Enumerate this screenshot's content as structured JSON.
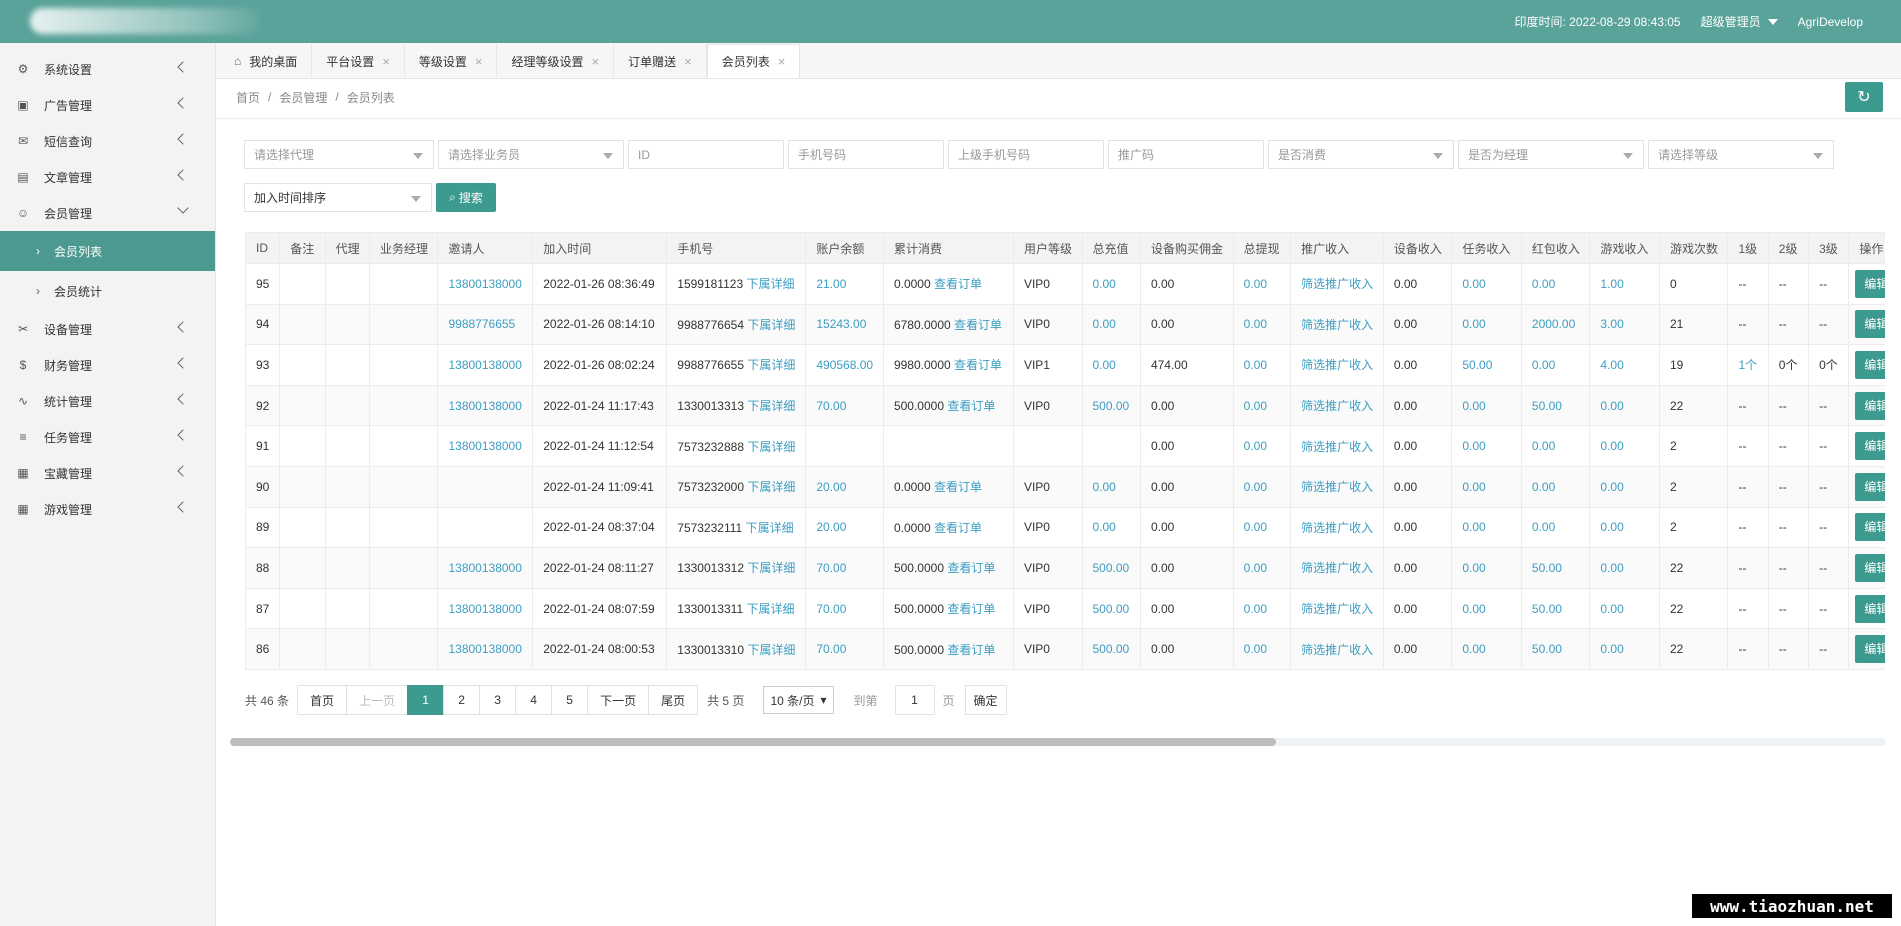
{
  "topbar": {
    "india_time": "印度时间: 2022-08-29 08:43:05",
    "admin_label": "超级管理员",
    "user": "AgriDevelop"
  },
  "sidebar": {
    "items": [
      {
        "label": "系统设置",
        "icon": "gear-icon",
        "glyph": "⚙"
      },
      {
        "label": "广告管理",
        "icon": "image-icon",
        "glyph": "▣"
      },
      {
        "label": "短信查询",
        "icon": "mail-icon",
        "glyph": "✉"
      },
      {
        "label": "文章管理",
        "icon": "book-icon",
        "glyph": "▤"
      },
      {
        "label": "会员管理",
        "icon": "user-icon",
        "glyph": "☺"
      }
    ],
    "sub_items": [
      {
        "label": "会员列表"
      },
      {
        "label": "会员统计"
      }
    ],
    "items2": [
      {
        "label": "设备管理",
        "icon": "wrench-icon",
        "glyph": "✂"
      },
      {
        "label": "财务管理",
        "icon": "dollar-icon",
        "glyph": "$"
      },
      {
        "label": "统计管理",
        "icon": "pulse-icon",
        "glyph": "∿"
      },
      {
        "label": "任务管理",
        "icon": "sliders-icon",
        "glyph": "≡"
      },
      {
        "label": "宝藏管理",
        "icon": "gift-icon",
        "glyph": "▦"
      },
      {
        "label": "游戏管理",
        "icon": "gift-icon",
        "glyph": "▦"
      }
    ]
  },
  "tabs": [
    {
      "label": "我的桌面"
    },
    {
      "label": "平台设置"
    },
    {
      "label": "等级设置"
    },
    {
      "label": "经理等级设置"
    },
    {
      "label": "订单赠送"
    },
    {
      "label": "会员列表"
    }
  ],
  "breadcrumb": [
    "首页",
    "会员管理",
    "会员列表"
  ],
  "filters": {
    "row1": [
      {
        "text": "请选择代理",
        "type": "select",
        "w": 190
      },
      {
        "text": "请选择业务员",
        "type": "select",
        "w": 186
      },
      {
        "text": "ID",
        "type": "input",
        "w": 156
      },
      {
        "text": "手机号码",
        "type": "input",
        "w": 156
      },
      {
        "text": "上级手机号码",
        "type": "input",
        "w": 156
      },
      {
        "text": "推广码",
        "type": "input",
        "w": 156
      },
      {
        "text": "是否消费",
        "type": "select",
        "w": 186
      },
      {
        "text": "是否为经理",
        "type": "select",
        "w": 186
      },
      {
        "text": "请选择等级",
        "type": "select",
        "w": 186
      }
    ],
    "sort": "加入时间排序",
    "search_label": "搜索"
  },
  "table": {
    "headers": [
      "ID",
      "备注",
      "代理",
      "业务经理",
      "邀请人",
      "加入时间",
      "手机号",
      "账户余额",
      "累计消费",
      "用户等级",
      "总充值",
      "设备购买佣金",
      "总提现",
      "推广收入",
      "设备收入",
      "任务收入",
      "红包收入",
      "游戏收入",
      "游戏次数",
      "1级",
      "2级",
      "3级",
      "操作"
    ],
    "detail_link": "下属详细",
    "order_link": "查看订单",
    "promo_link": "筛选推广收入",
    "edit_label": "编辑",
    "rows": [
      {
        "id": "95",
        "inviter": "13800138000",
        "time": "2022-01-26 08:36:49",
        "phone": "1599181123",
        "balance": "21.00",
        "consume": "0.0000",
        "level": "VIP0",
        "recharge": "0.00",
        "device_comm": "0.00",
        "withdraw": "0.00",
        "device_inc": "0.00",
        "task_inc": "0.00",
        "red_inc": "0.00",
        "game_inc": "1.00",
        "game_cnt": "0",
        "l1": "--",
        "l2": "--",
        "l3": "--"
      },
      {
        "id": "94",
        "inviter": "9988776655",
        "time": "2022-01-26 08:14:10",
        "phone": "9988776654",
        "balance": "15243.00",
        "consume": "6780.0000",
        "level": "VIP0",
        "recharge": "0.00",
        "device_comm": "0.00",
        "withdraw": "0.00",
        "device_inc": "0.00",
        "task_inc": "0.00",
        "red_inc": "2000.00",
        "game_inc": "3.00",
        "game_cnt": "21",
        "l1": "--",
        "l2": "--",
        "l3": "--"
      },
      {
        "id": "93",
        "inviter": "13800138000",
        "time": "2022-01-26 08:02:24",
        "phone": "9988776655",
        "balance": "490568.00",
        "consume": "9980.0000",
        "level": "VIP1",
        "recharge": "0.00",
        "device_comm": "474.00",
        "withdraw": "0.00",
        "device_inc": "0.00",
        "task_inc": "50.00",
        "red_inc": "0.00",
        "game_inc": "4.00",
        "game_cnt": "19",
        "l1": "1个",
        "l2": "0个",
        "l3": "0个"
      },
      {
        "id": "92",
        "inviter": "13800138000",
        "time": "2022-01-24 11:17:43",
        "phone": "1330013313",
        "balance": "70.00",
        "consume": "500.0000",
        "level": "VIP0",
        "recharge": "500.00",
        "device_comm": "0.00",
        "withdraw": "0.00",
        "device_inc": "0.00",
        "task_inc": "0.00",
        "red_inc": "50.00",
        "game_inc": "0.00",
        "game_cnt": "22",
        "l1": "--",
        "l2": "--",
        "l3": "--"
      },
      {
        "id": "91",
        "inviter": "13800138000",
        "time": "2022-01-24 11:12:54",
        "phone": "7573232888",
        "balance": "",
        "consume": "",
        "level": "",
        "recharge": "",
        "device_comm": "0.00",
        "withdraw": "0.00",
        "device_inc": "0.00",
        "task_inc": "0.00",
        "red_inc": "0.00",
        "game_inc": "0.00",
        "game_cnt": "2",
        "l1": "--",
        "l2": "--",
        "l3": "--"
      },
      {
        "id": "90",
        "inviter": "",
        "time": "2022-01-24 11:09:41",
        "phone": "7573232000",
        "balance": "20.00",
        "consume": "0.0000",
        "level": "VIP0",
        "recharge": "0.00",
        "device_comm": "0.00",
        "withdraw": "0.00",
        "device_inc": "0.00",
        "task_inc": "0.00",
        "red_inc": "0.00",
        "game_inc": "0.00",
        "game_cnt": "2",
        "l1": "--",
        "l2": "--",
        "l3": "--"
      },
      {
        "id": "89",
        "inviter": "",
        "time": "2022-01-24 08:37:04",
        "phone": "7573232111",
        "balance": "20.00",
        "consume": "0.0000",
        "level": "VIP0",
        "recharge": "0.00",
        "device_comm": "0.00",
        "withdraw": "0.00",
        "device_inc": "0.00",
        "task_inc": "0.00",
        "red_inc": "0.00",
        "game_inc": "0.00",
        "game_cnt": "2",
        "l1": "--",
        "l2": "--",
        "l3": "--"
      },
      {
        "id": "88",
        "inviter": "13800138000",
        "time": "2022-01-24 08:11:27",
        "phone": "1330013312",
        "balance": "70.00",
        "consume": "500.0000",
        "level": "VIP0",
        "recharge": "500.00",
        "device_comm": "0.00",
        "withdraw": "0.00",
        "device_inc": "0.00",
        "task_inc": "0.00",
        "red_inc": "50.00",
        "game_inc": "0.00",
        "game_cnt": "22",
        "l1": "--",
        "l2": "--",
        "l3": "--"
      },
      {
        "id": "87",
        "inviter": "13800138000",
        "time": "2022-01-24 08:07:59",
        "phone": "1330013311",
        "balance": "70.00",
        "consume": "500.0000",
        "level": "VIP0",
        "recharge": "500.00",
        "device_comm": "0.00",
        "withdraw": "0.00",
        "device_inc": "0.00",
        "task_inc": "0.00",
        "red_inc": "50.00",
        "game_inc": "0.00",
        "game_cnt": "22",
        "l1": "--",
        "l2": "--",
        "l3": "--"
      },
      {
        "id": "86",
        "inviter": "13800138000",
        "time": "2022-01-24 08:00:53",
        "phone": "1330013310",
        "balance": "70.00",
        "consume": "500.0000",
        "level": "VIP0",
        "recharge": "500.00",
        "device_comm": "0.00",
        "withdraw": "0.00",
        "device_inc": "0.00",
        "task_inc": "0.00",
        "red_inc": "50.00",
        "game_inc": "0.00",
        "game_cnt": "22",
        "l1": "--",
        "l2": "--",
        "l3": "--"
      }
    ]
  },
  "pager": {
    "total": "共 46 条",
    "first": "首页",
    "prev": "上一页",
    "pages": [
      "1",
      "2",
      "3",
      "4",
      "5"
    ],
    "next": "下一页",
    "last": "尾页",
    "page_count": "共 5 页",
    "per_page": "10 条/页",
    "goto": "到第",
    "goto_value": "1",
    "page_unit": "页",
    "confirm": "确定"
  },
  "watermark": "www.tiaozhuan.net"
}
